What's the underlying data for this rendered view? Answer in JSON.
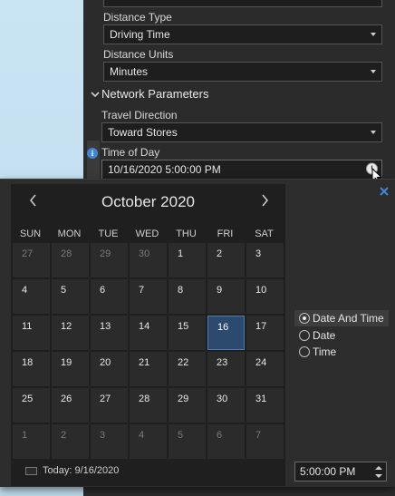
{
  "panel": {
    "distance_type_label": "Distance Type",
    "distance_type_value": "Driving Time",
    "distance_units_label": "Distance Units",
    "distance_units_value": "Minutes",
    "network_section_title": "Network Parameters",
    "travel_direction_label": "Travel Direction",
    "travel_direction_value": "Toward Stores",
    "time_of_day_label": "Time of Day",
    "time_of_day_value": "10/16/2020 5:00:00 PM"
  },
  "calendar": {
    "month_title": "October 2020",
    "weekdays": [
      "SUN",
      "MON",
      "TUE",
      "WED",
      "THU",
      "FRI",
      "SAT"
    ],
    "days": [
      [
        "27",
        "28",
        "29",
        "30",
        "1",
        "2",
        "3"
      ],
      [
        "4",
        "5",
        "6",
        "7",
        "8",
        "9",
        "10"
      ],
      [
        "11",
        "12",
        "13",
        "14",
        "15",
        "16",
        "17"
      ],
      [
        "18",
        "19",
        "20",
        "21",
        "22",
        "23",
        "24"
      ],
      [
        "25",
        "26",
        "27",
        "28",
        "29",
        "30",
        "31"
      ],
      [
        "1",
        "2",
        "3",
        "4",
        "5",
        "6",
        "7"
      ]
    ],
    "selected_day": "16",
    "today_label": "Today: 9/16/2020"
  },
  "options": {
    "mode_date_and_time": "Date And Time",
    "mode_date": "Date",
    "mode_time": "Time",
    "selected_mode": "Date And Time"
  },
  "time_field": {
    "value": "5:00:00 PM"
  },
  "colors": {
    "accent": "#2c4a6e",
    "info": "#3f86d6"
  }
}
